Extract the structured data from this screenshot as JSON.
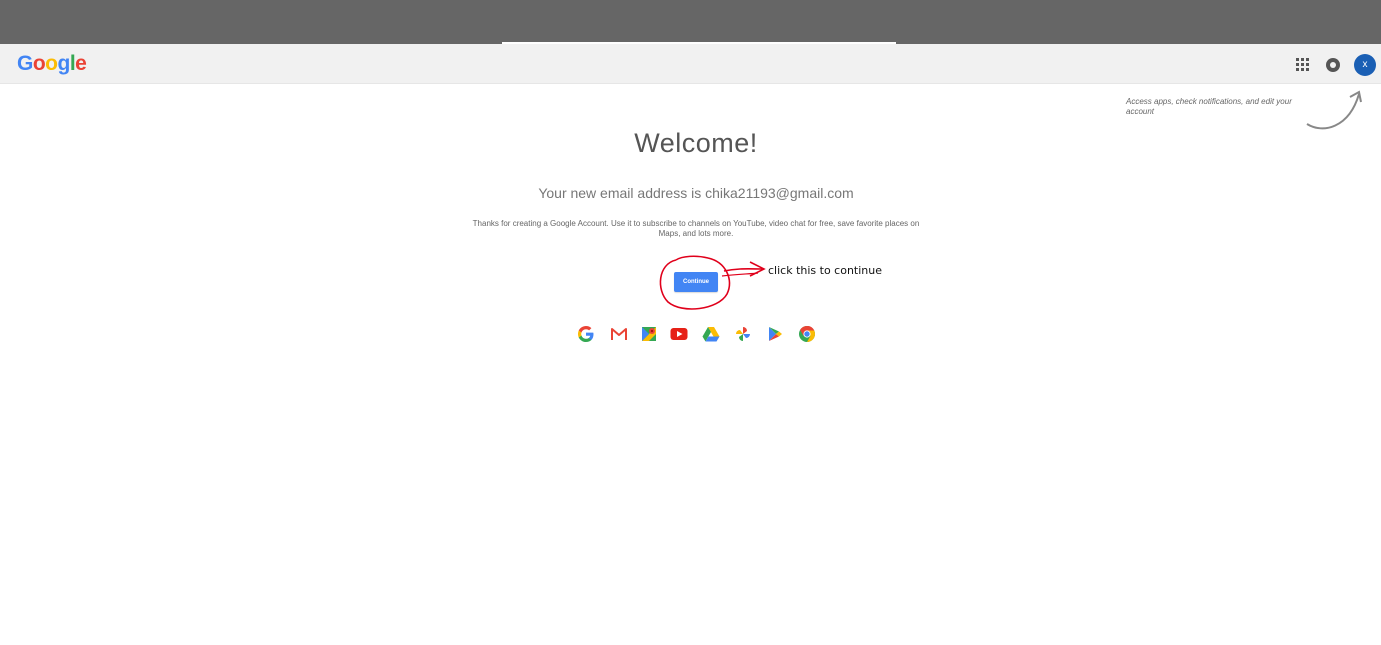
{
  "appbar": {
    "logo_letters": [
      {
        "ch": "G",
        "color": "#4285f4"
      },
      {
        "ch": "o",
        "color": "#ea4335"
      },
      {
        "ch": "o",
        "color": "#fbbc05"
      },
      {
        "ch": "g",
        "color": "#4285f4"
      },
      {
        "ch": "l",
        "color": "#34a853"
      },
      {
        "ch": "e",
        "color": "#ea4335"
      }
    ],
    "apps_icon": "apps-grid-icon",
    "notifications_icon": "notifications-icon",
    "avatar_initial": "x"
  },
  "hint": {
    "text": "Access apps, check notifications, and edit your account"
  },
  "main": {
    "title": "Welcome!",
    "subtitle": "Your new email address is chika21193@gmail.com",
    "description": "Thanks for creating a Google Account. Use it to subscribe to channels on YouTube, video chat for free, save favorite places on Maps, and lots more.",
    "continue_label": "Continue"
  },
  "annotation": {
    "text": "click this to continue",
    "color": "#e0001b"
  },
  "products": [
    "google-g-icon",
    "gmail-icon",
    "maps-icon",
    "youtube-icon",
    "drive-icon",
    "photos-icon",
    "play-icon",
    "chrome-icon"
  ],
  "colors": {
    "accent": "#4285f4",
    "appbar_bg": "#f1f1f1",
    "avatar_bg": "#1a5fb4"
  }
}
